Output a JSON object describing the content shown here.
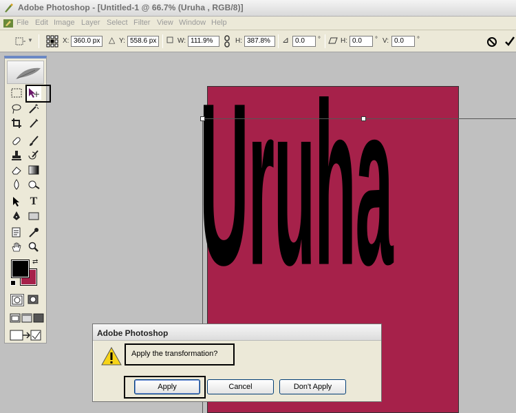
{
  "window": {
    "title": "Adobe Photoshop - [Untitled-1 @ 66.7% (Uruha      , RGB/8)]"
  },
  "menu": {
    "items": [
      "File",
      "Edit",
      "Image",
      "Layer",
      "Select",
      "Filter",
      "View",
      "Window",
      "Help"
    ]
  },
  "options": {
    "x_label": "X:",
    "x_value": "360.0 px",
    "y_label": "Y:",
    "y_value": "558.6 px",
    "w_label": "W:",
    "w_value": "111.9%",
    "h_label": "H:",
    "h_value": "387.8%",
    "angle_value": "0.0",
    "deg_symbol": "°",
    "hskew_label": "H:",
    "hskew_value": "0.0",
    "vskew_label": "V:",
    "vskew_value": "0.0"
  },
  "document": {
    "text": "Uruha",
    "background_color": "#a6214a"
  },
  "colors": {
    "foreground": "#000000",
    "background": "#a6214a"
  },
  "dialog": {
    "title": "Adobe Photoshop",
    "message": "Apply the transformation?",
    "apply_label": "Apply",
    "cancel_label": "Cancel",
    "dont_apply_label": "Don't Apply"
  }
}
